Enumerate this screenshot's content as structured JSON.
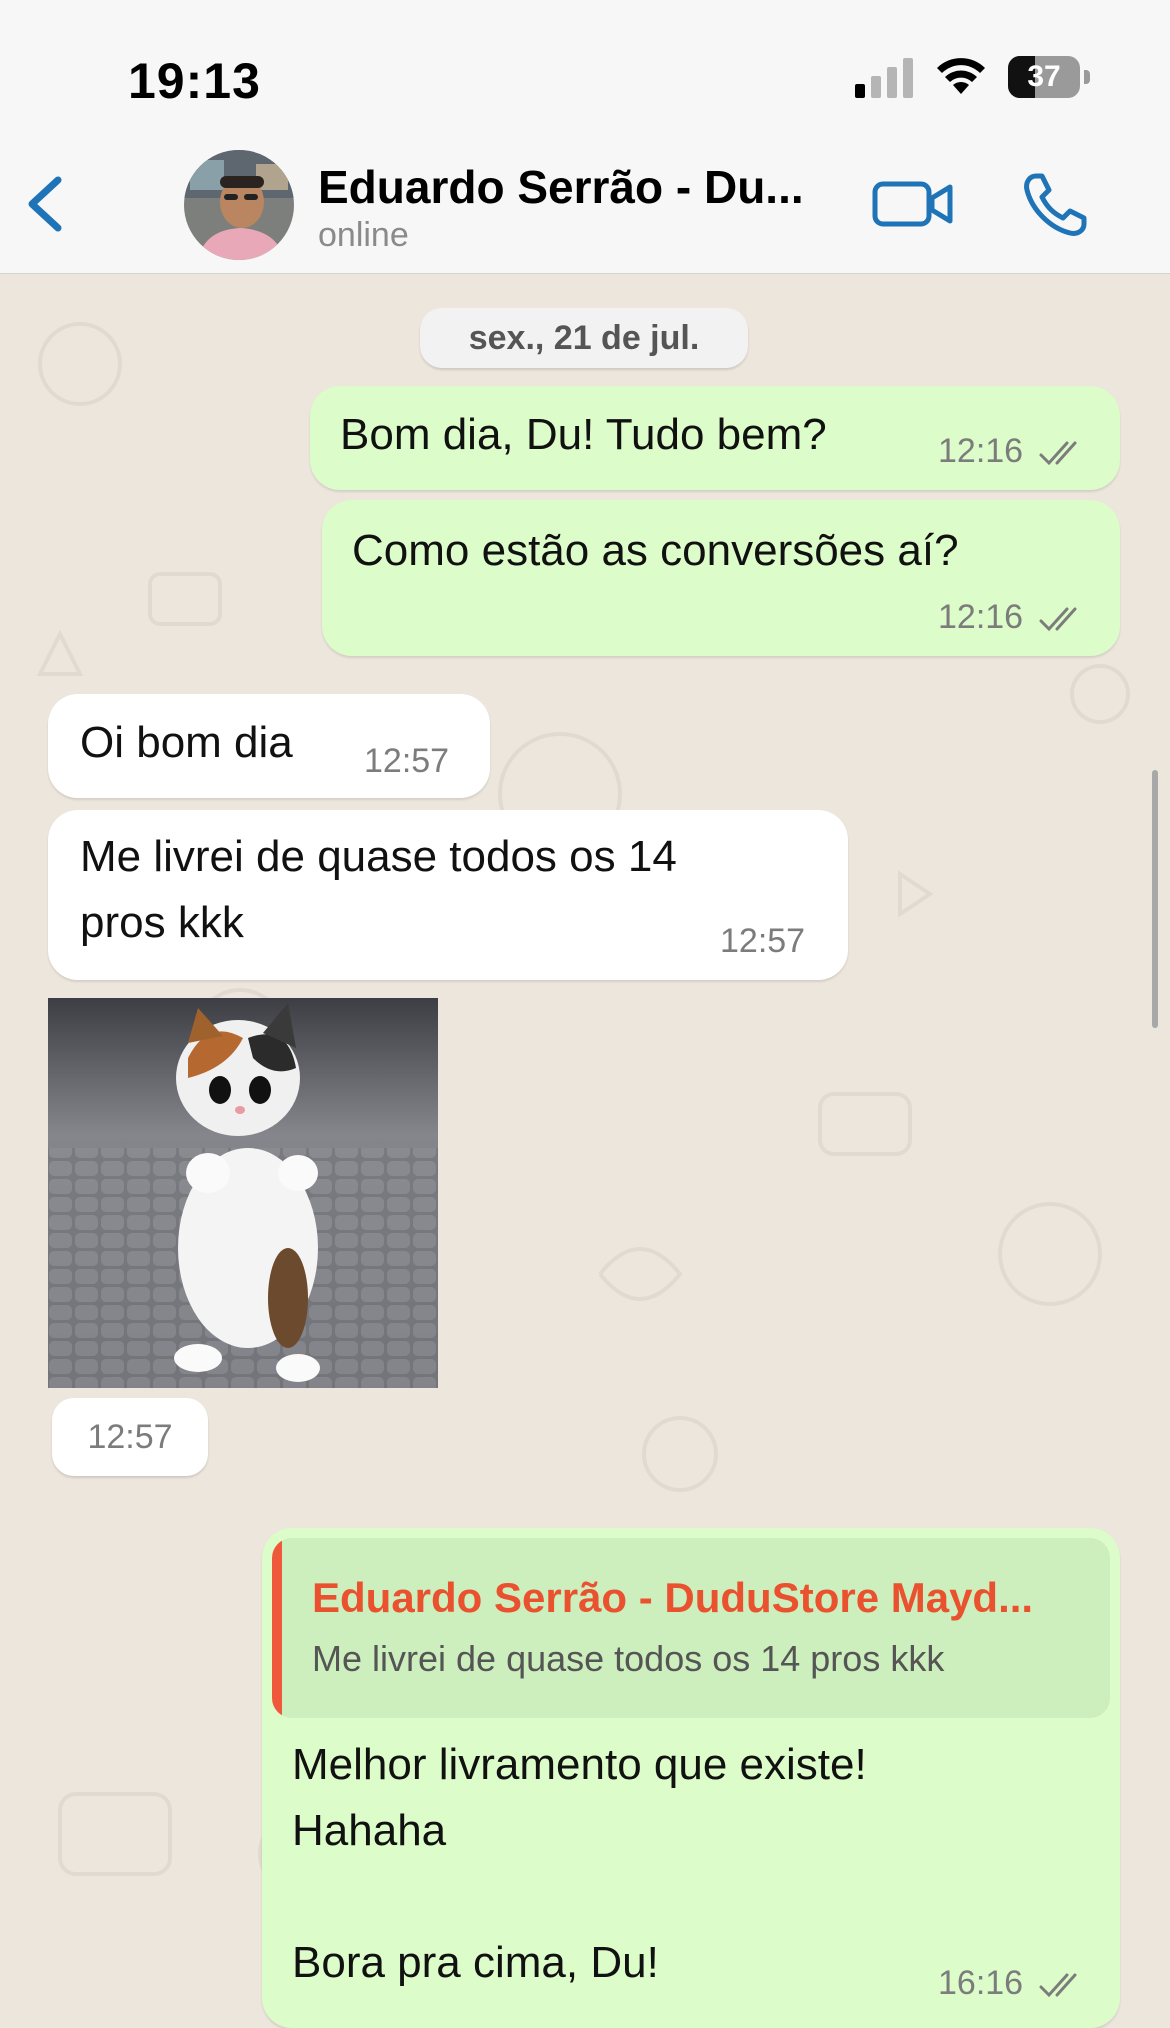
{
  "status_bar": {
    "time": "19:13",
    "battery": "37",
    "battery_level": 0.37
  },
  "header": {
    "contact_name": "Eduardo Serrão - Du...",
    "status": "online"
  },
  "chat": {
    "date_separator": "sex., 21 de jul.",
    "messages": [
      {
        "direction": "outgoing",
        "text": "Bom dia, Du! Tudo bem?",
        "time": "12:16",
        "read": true
      },
      {
        "direction": "outgoing",
        "text": "Como estão as conversões aí?",
        "time": "12:16",
        "read": true
      },
      {
        "direction": "incoming",
        "text": "Oi bom dia",
        "time": "12:57"
      },
      {
        "direction": "incoming",
        "lines": [
          "Me livrei de quase todos os 14",
          "pros kkk"
        ],
        "time": "12:57"
      },
      {
        "direction": "incoming",
        "type": "sticker",
        "time": "12:57"
      },
      {
        "direction": "outgoing",
        "reply_to": {
          "author": "Eduardo Serrão - DuduStore Mayd...",
          "text": "Me livrei de quase todos os 14 pros kkk"
        },
        "lines": [
          "Melhor livramento que existe!",
          "Hahaha",
          "",
          "Bora pra cima, Du!"
        ],
        "time": "16:16",
        "read": true
      }
    ]
  },
  "colors": {
    "accent": "#1f73b7",
    "outgoing_bubble": "#dcfcc9",
    "incoming_bubble": "#ffffff",
    "chat_background": "#ece6dc",
    "read_ticks": "#7c7c7c",
    "quote_author": "#e9512f"
  },
  "icons": {
    "back": "chevron-left-icon",
    "video": "video-camera-icon",
    "call": "phone-icon",
    "signal": "cellular-signal-icon",
    "wifi": "wifi-icon",
    "battery": "battery-icon"
  }
}
